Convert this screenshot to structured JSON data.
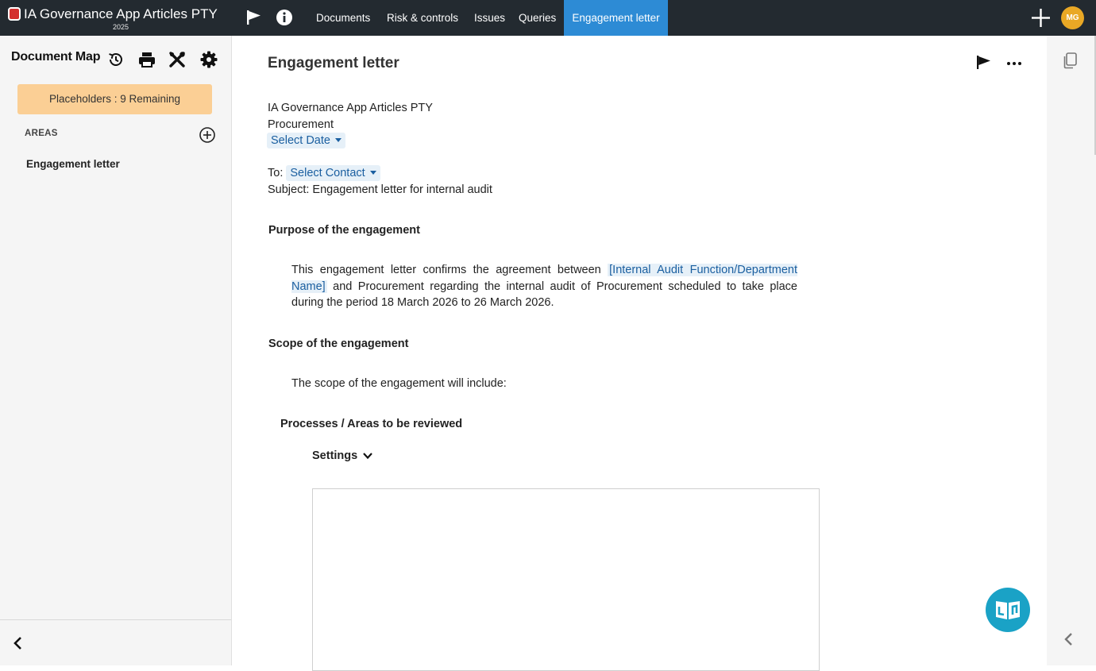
{
  "app": {
    "title": "IA Governance App Articles PTY",
    "year": "2025",
    "brand_color": "#d4302f"
  },
  "top_icons": [
    "flag-icon",
    "info-icon",
    "plus-icon"
  ],
  "nav": {
    "tabs": [
      {
        "label": "Documents",
        "active": false
      },
      {
        "label": "Risk & controls",
        "active": false
      },
      {
        "label": "Issues",
        "active": false
      },
      {
        "label": "Queries",
        "active": false
      },
      {
        "label": "Engagement letter",
        "active": true
      }
    ],
    "active_color": "#2d8bd5"
  },
  "user": {
    "initials": "MG",
    "avatar_color": "#e9a825"
  },
  "sidebar": {
    "title": "Document Map",
    "tools": [
      "history-icon",
      "print-icon",
      "tools-icon",
      "gear-icon"
    ],
    "placeholders": "Placeholders : 9 Remaining",
    "areas_label": "AREAS",
    "areas": [
      {
        "label": "Engagement letter"
      }
    ]
  },
  "document": {
    "title": "Engagement letter",
    "org": "IA Governance App Articles PTY",
    "department": "Procurement",
    "date_select": "Select Date",
    "to_label": "To:",
    "contact_select": "Select Contact",
    "subject": "Subject: Engagement letter for internal audit",
    "purpose_heading": "Purpose of the engagement",
    "purpose_pre": "This engagement letter confirms the agreement between ",
    "purpose_placeholder": "[Internal Audit Function/Department Name]",
    "purpose_post": " and Procurement regarding the internal audit of Procurement scheduled to take place during the period 18 March 2026 to 26 March 2026.",
    "scope_heading": "Scope of the engagement",
    "scope_intro": "The scope of the engagement will include:",
    "processes_heading": "Processes / Areas to be reviewed",
    "settings_label": "Settings"
  },
  "colors": {
    "topbar": "#232a30",
    "placeholder_badge": "#fbcf95",
    "chip_bg": "#e6f0f8",
    "chip_text": "#1b5fa0",
    "help_fab": "#1aa2c6"
  }
}
